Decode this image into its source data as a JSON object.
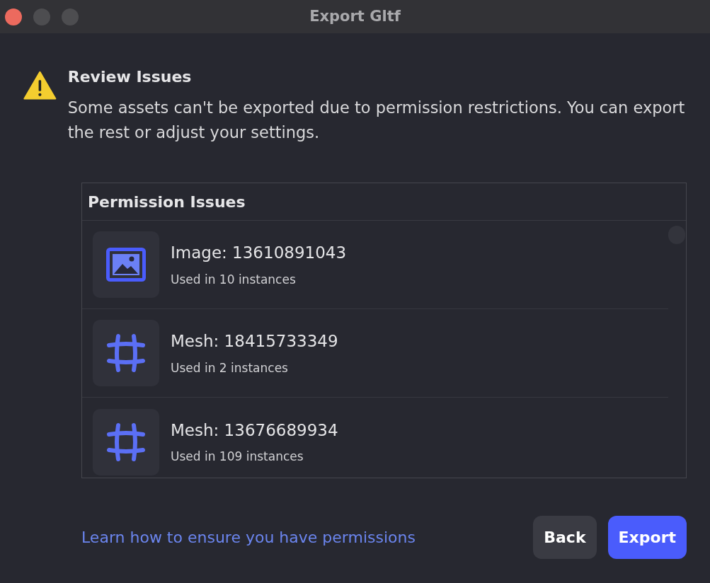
{
  "window": {
    "title": "Export Gltf"
  },
  "header": {
    "title": "Review Issues",
    "message": "Some assets can't be exported due to permission restrictions. You can export the rest or adjust your settings."
  },
  "panel": {
    "title": "Permission Issues",
    "items": [
      {
        "kind": "image",
        "name": "Image: 13610891043",
        "usage": "Used in 10 instances"
      },
      {
        "kind": "mesh",
        "name": "Mesh: 18415733349",
        "usage": "Used in 2 instances"
      },
      {
        "kind": "mesh",
        "name": "Mesh: 13676689934",
        "usage": "Used in 109 instances"
      }
    ]
  },
  "footer": {
    "link": "Learn how to ensure you have permissions",
    "buttons": [
      {
        "label": "Back",
        "kind": "secondary"
      },
      {
        "label": "Export",
        "kind": "primary"
      }
    ]
  }
}
